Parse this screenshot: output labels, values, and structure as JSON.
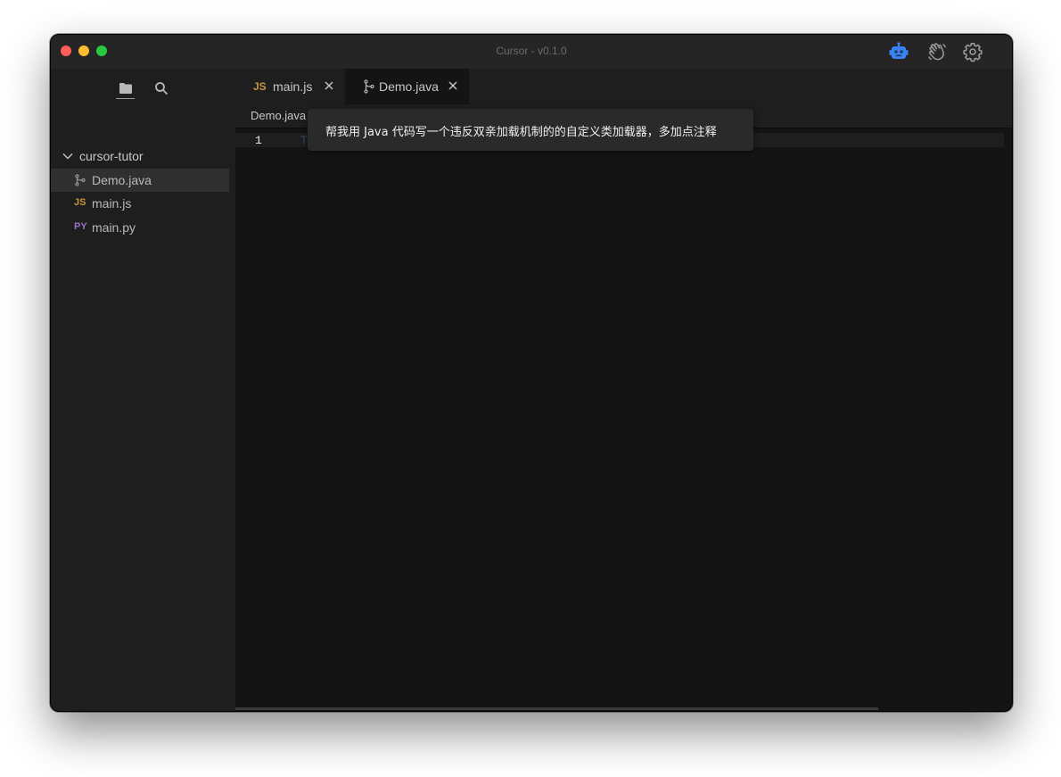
{
  "window": {
    "title": "Cursor - v0.1.0"
  },
  "titlebar_icons": {
    "robot": "robot-icon",
    "hand": "wave-hand-icon",
    "settings": "gear-icon",
    "accent": "#3b82f6"
  },
  "sidebar": {
    "tabs": [
      {
        "name": "files",
        "icon": "folder-icon",
        "active": true
      },
      {
        "name": "search",
        "icon": "search-icon",
        "active": false
      }
    ],
    "folder": "cursor-tutor",
    "files": [
      {
        "label": "Demo.java",
        "badge": "",
        "active": true
      },
      {
        "label": "main.js",
        "badge": "JS",
        "active": false
      },
      {
        "label": "main.py",
        "badge": "PY",
        "active": false
      }
    ]
  },
  "tabs": [
    {
      "label": "main.js",
      "badge": "JS",
      "active": false
    },
    {
      "label": "Demo.java",
      "badge": "",
      "active": true
    }
  ],
  "editor": {
    "breadcrumb": "Demo.java",
    "line_number": "1",
    "ghost_text": "T"
  },
  "prompt": {
    "text": "帮我用 Java 代码写一个违反双亲加载机制的的自定义类加载器，多加点注释"
  }
}
